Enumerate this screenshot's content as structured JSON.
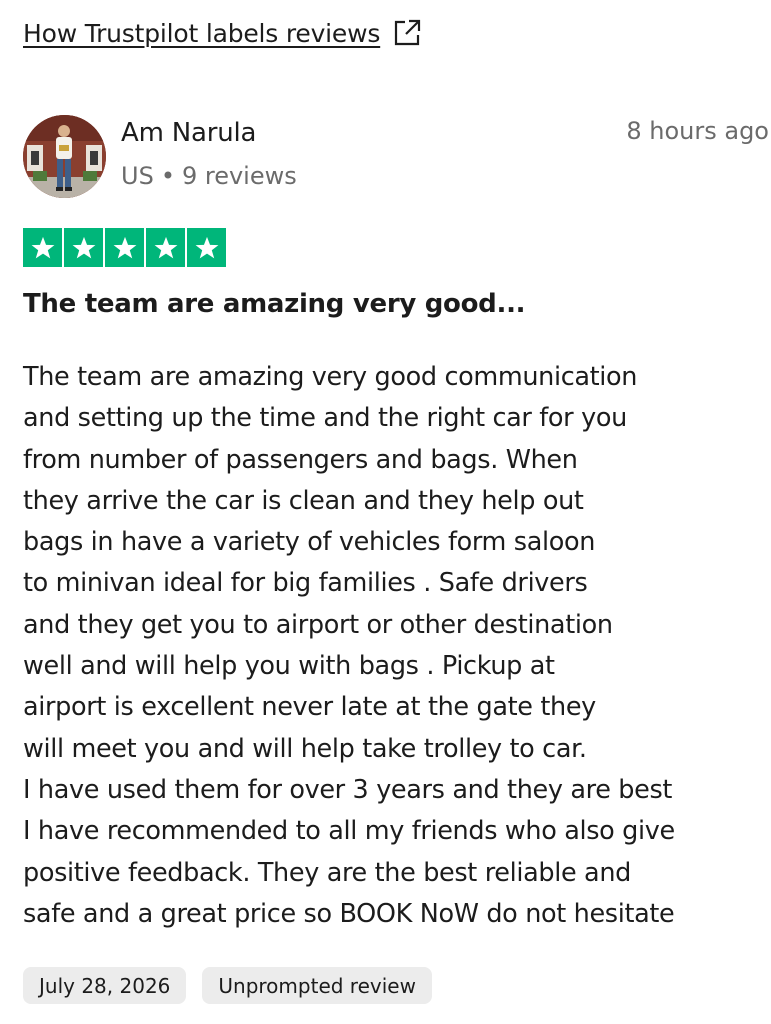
{
  "header": {
    "labels_link_text": "How Trustpilot labels reviews",
    "labels_link_icon": "external-link-icon"
  },
  "reviewer": {
    "name": "Am Narula",
    "country": "US",
    "reviews_count": "9 reviews",
    "avatar_icon": "user-avatar-photo"
  },
  "review": {
    "time_ago": "8 hours ago",
    "rating": 5,
    "rating_max": 5,
    "star_color": "#00b67a",
    "title": "The team are amazing very good...",
    "body_lines": [
      "The team are amazing very good communication",
      "and setting up the time and the right car for you",
      "from number of passengers and bags. When",
      "they arrive the car is clean and they help out",
      "bags in have a variety of vehicles form saloon",
      "to minivan ideal for big families . Safe drivers",
      "and they get you to airport or other destination",
      "well and will help you with bags . Pickup at",
      "airport is excellent never late at the gate they",
      "will meet you and will help take trolley to car.",
      "I have used them for over 3 years and they are best",
      "I have recommended to all my friends who also give",
      "positive feedback. They are the best reliable and",
      "safe and a great price so BOOK NoW do not hesitate"
    ],
    "tags": [
      "July 28, 2026",
      "Unprompted review"
    ]
  }
}
